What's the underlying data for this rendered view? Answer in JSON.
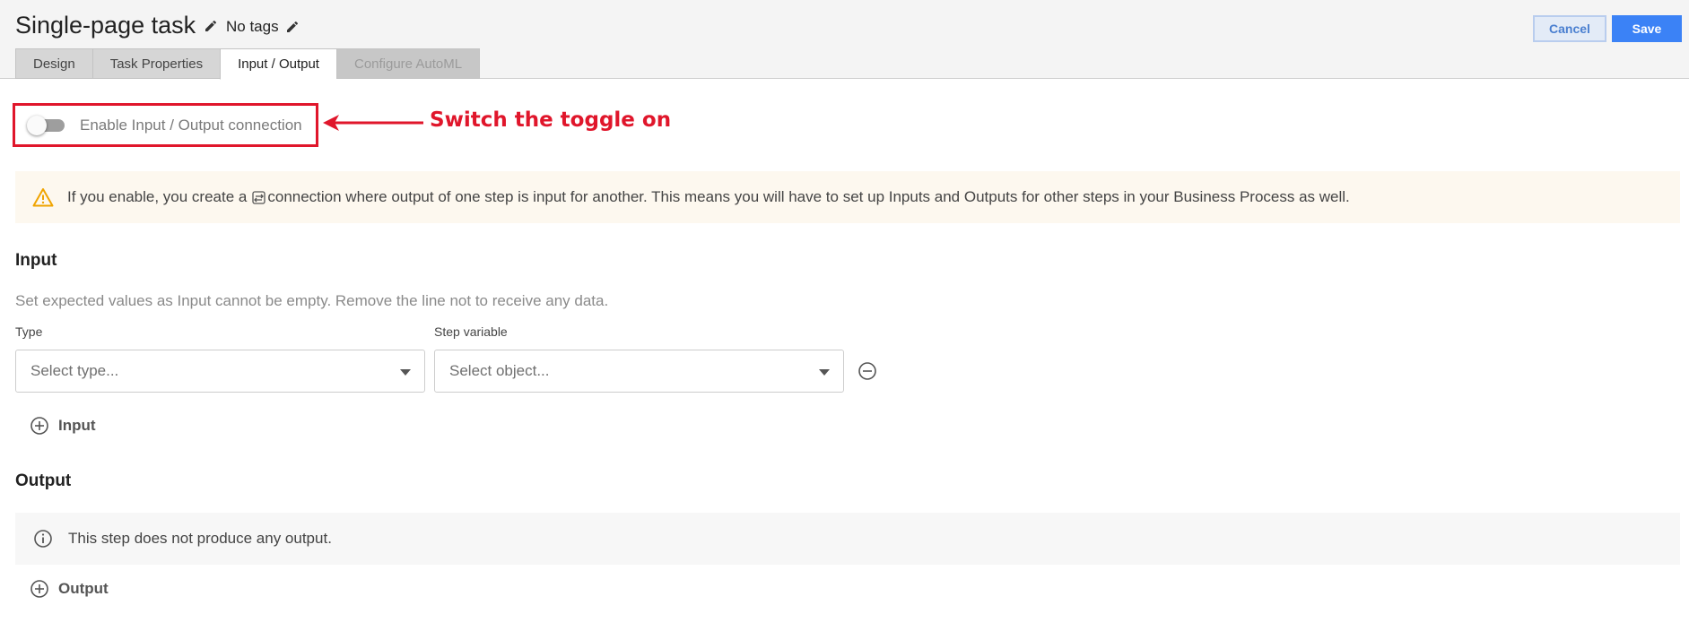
{
  "header": {
    "title": "Single-page task",
    "tags": "No tags",
    "cancel_label": "Cancel",
    "save_label": "Save"
  },
  "tabs": [
    {
      "label": "Design",
      "state": "normal"
    },
    {
      "label": "Task Properties",
      "state": "normal"
    },
    {
      "label": "Input / Output",
      "state": "active"
    },
    {
      "label": "Configure AutoML",
      "state": "disabled"
    }
  ],
  "io_toggle": {
    "label": "Enable Input / Output connection",
    "enabled": false
  },
  "annotation": {
    "text": "Switch the toggle on",
    "color": "#e0162b"
  },
  "warning": {
    "text_before": "If you enable, you create a",
    "text_after": "connection where output of one step is input for another. This means you will have to set up Inputs and Outputs for other steps in your Business Process as well."
  },
  "input": {
    "title": "Input",
    "hint": "Set expected values as Input cannot be empty. Remove the line not to receive any data.",
    "type_label": "Type",
    "type_placeholder": "Select type...",
    "variable_label": "Step variable",
    "variable_placeholder": "Select object...",
    "add_label": "Input"
  },
  "output": {
    "title": "Output",
    "info": "This step does not produce any output.",
    "add_label": "Output"
  },
  "colors": {
    "accent": "#3b82f6",
    "warning_icon": "#f0a400",
    "annotation_red": "#e0162b"
  }
}
